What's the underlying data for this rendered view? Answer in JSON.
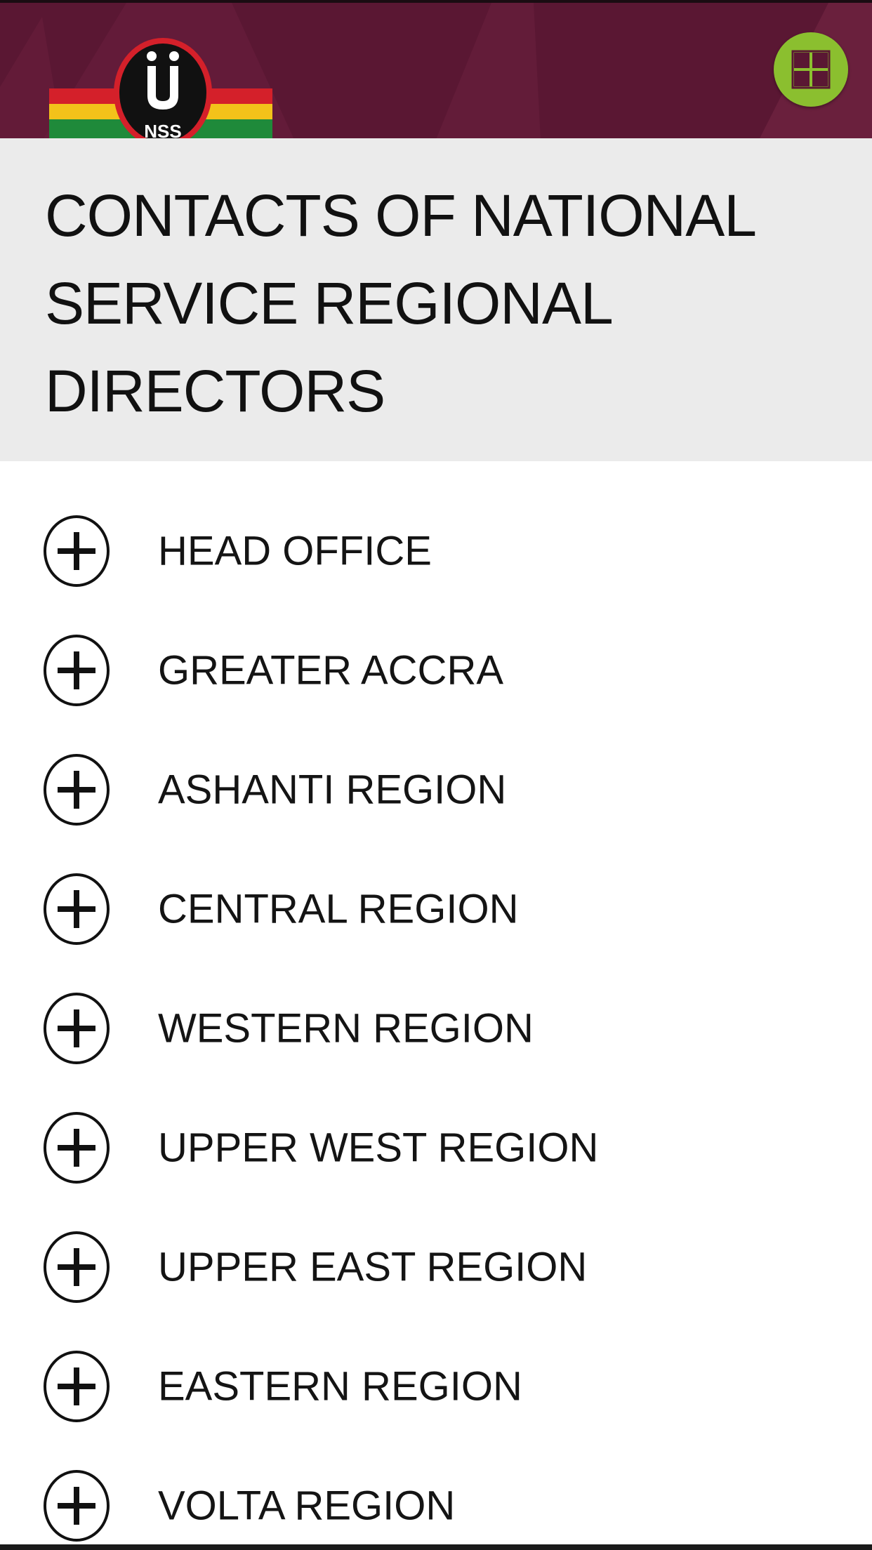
{
  "header": {
    "logo_text": "NSS",
    "colors": {
      "background": "#5a1733",
      "menu_button": "#8bbf2f",
      "flag_red": "#d4202a",
      "flag_gold": "#f3c21a",
      "flag_green": "#1f8a3a"
    },
    "logo_icon": "nss-logo",
    "menu_icon": "grid-icon"
  },
  "page": {
    "title": "CONTACTS OF NATIONAL SERVICE REGIONAL DIRECTORS"
  },
  "regions": {
    "expand_icon": "plus-circle-icon",
    "items": [
      {
        "label": "HEAD OFFICE"
      },
      {
        "label": "GREATER ACCRA"
      },
      {
        "label": "ASHANTI REGION"
      },
      {
        "label": "CENTRAL REGION"
      },
      {
        "label": "WESTERN REGION"
      },
      {
        "label": "UPPER WEST REGION"
      },
      {
        "label": "UPPER EAST REGION"
      },
      {
        "label": "EASTERN REGION"
      },
      {
        "label": "VOLTA REGION"
      }
    ]
  }
}
